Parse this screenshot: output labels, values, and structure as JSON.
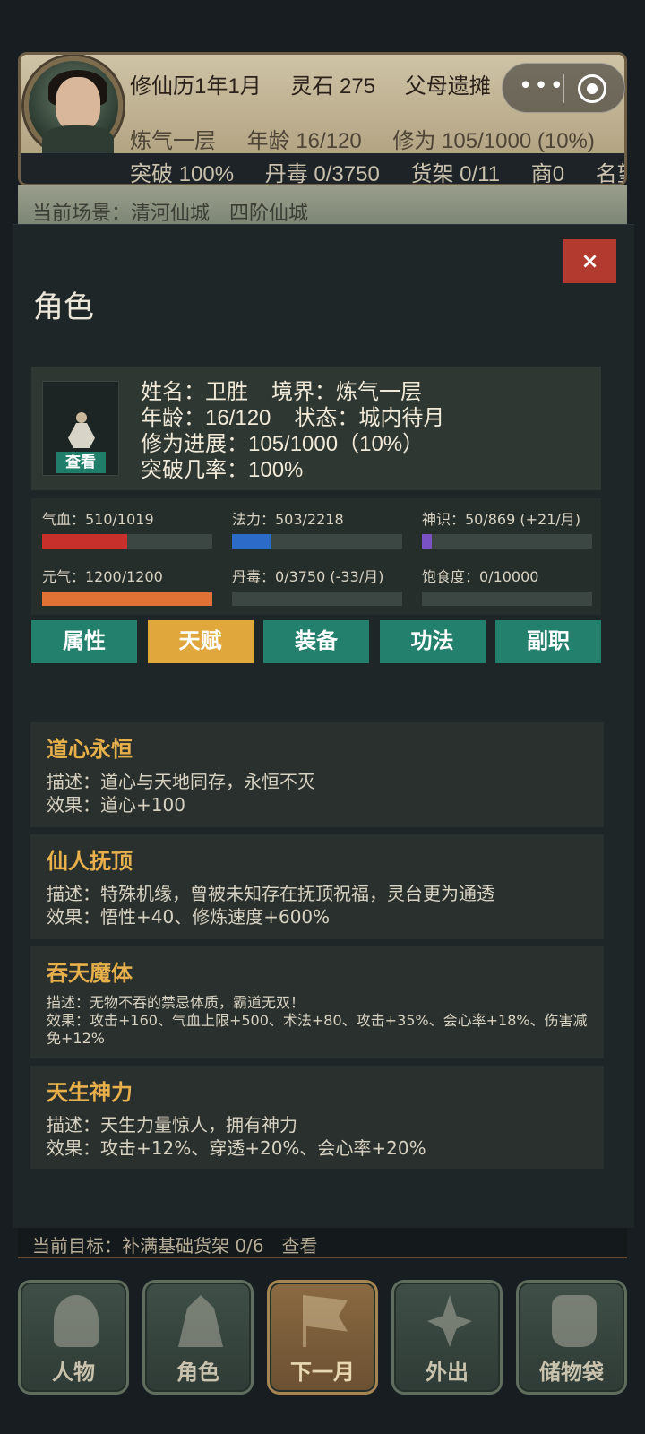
{
  "hud": {
    "row1": [
      "修仙历1年1月",
      "灵石 275",
      "父母遗摊"
    ],
    "row2": [
      "炼气一层",
      "年龄 16/120",
      "修为 105/1000 (10%)"
    ],
    "row3": [
      "突破 100%",
      "丹毒 0/3750",
      "货架 0/11",
      "商0",
      "名望"
    ],
    "scene": "当前场景：清河仙城　四阶仙城",
    "goal": "当前目标：补满基础货架 0/6　查看"
  },
  "capsule": {
    "more_glyph": "•••"
  },
  "modal": {
    "close_label": "×",
    "title": "角色",
    "character": {
      "view_label": "查看",
      "name_line": "姓名：卫胜",
      "realm_line": "境界：炼气一层",
      "age_line": "年龄：16/120",
      "status_line": "状态：城内待月",
      "progress_line": "修为进展：105/1000（10%）",
      "breakthrough_line": "突破几率：100%"
    },
    "stats": [
      {
        "label": "气血：510/1019",
        "fill": 0.5,
        "color": "#c8302c"
      },
      {
        "label": "法力：503/2218",
        "fill": 0.23,
        "color": "#2d6bc9"
      },
      {
        "label": "神识：50/869 (+21/月)",
        "fill": 0.06,
        "color": "#7b52c4"
      },
      {
        "label": "元气：1200/1200",
        "fill": 1.0,
        "color": "#e07236"
      },
      {
        "label": "丹毒：0/3750 (-33/月)",
        "fill": 0.0,
        "color": "#888888"
      },
      {
        "label": "饱食度：0/10000",
        "fill": 0.0,
        "color": "#888888"
      }
    ],
    "tabs": [
      "属性",
      "天赋",
      "装备",
      "功法",
      "副职"
    ],
    "active_tab": 1,
    "talents": [
      {
        "name": "道心永恒",
        "desc": "描述：道心与天地同存，永恒不灭",
        "effect": "效果：道心+100",
        "small": false
      },
      {
        "name": "仙人抚顶",
        "desc": "描述：特殊机缘，曾被未知存在抚顶祝福，灵台更为通透",
        "effect": "效果：悟性+40、修炼速度+600%",
        "small": false
      },
      {
        "name": "吞天魔体",
        "desc": "描述：无物不吞的禁忌体质，霸道无双！",
        "effect": "效果：攻击+160、气血上限+500、术法+80、攻击+35%、会心率+18%、伤害减免+12%",
        "small": true
      },
      {
        "name": "天生神力",
        "desc": "描述：天生力量惊人，拥有神力",
        "effect": "效果：攻击+12%、穿透+20%、会心率+20%",
        "small": false
      }
    ]
  },
  "bottom_nav": [
    {
      "label": "人物",
      "icon": "person-icon",
      "active": false
    },
    {
      "label": "角色",
      "icon": "robe-icon",
      "active": false
    },
    {
      "label": "下一月",
      "icon": "flag-icon",
      "active": true
    },
    {
      "label": "外出",
      "icon": "lotus-icon",
      "active": false
    },
    {
      "label": "储物袋",
      "icon": "bag-icon",
      "active": false
    }
  ]
}
